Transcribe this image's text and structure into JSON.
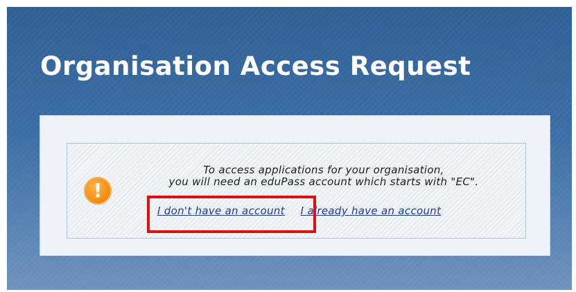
{
  "page": {
    "title": "Organisation Access Request"
  },
  "notice": {
    "icon": "exclamation-warning-icon",
    "icon_glyph": "!",
    "icon_color": "#f39014",
    "message_line1": "To access applications for your organisation,",
    "message_line2": "you will need an eduPass account which starts with \"EC\".",
    "link_no_account": "I don't have an account",
    "link_have_account": "I already have an account"
  },
  "annotation": {
    "highlight_color": "#e01010",
    "highlighted": "link_no_account"
  }
}
